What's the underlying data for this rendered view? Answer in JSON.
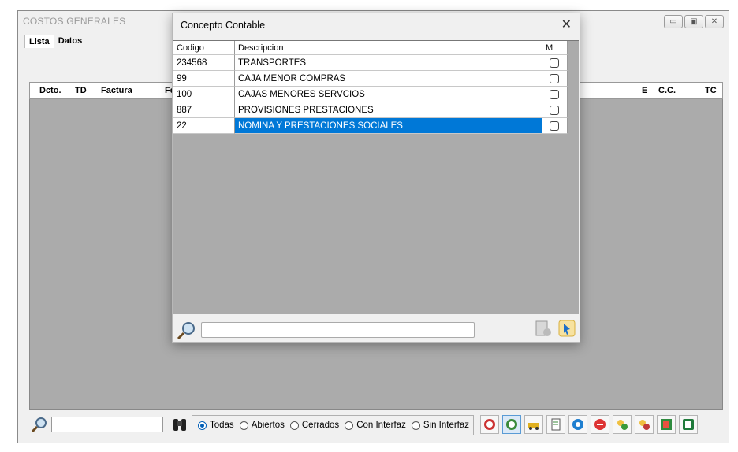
{
  "window": {
    "title": "COSTOS GENERALES",
    "tabs": [
      "Lista",
      "Datos"
    ],
    "columns": [
      "Dcto.",
      "TD",
      "Factura",
      "Fe",
      "E",
      "C.C.",
      "TC"
    ]
  },
  "filters": {
    "options": [
      "Todas",
      "Abiertos",
      "Cerrados",
      "Con Interfaz",
      "Sin Interfaz"
    ],
    "selected": "Todas"
  },
  "toolbar_icons": [
    "sales-icon",
    "receipt-icon",
    "truck-icon",
    "document-icon",
    "refresh-icon",
    "cancel-icon",
    "add-group-icon",
    "group-icon",
    "excel-grid-icon",
    "export-excel-icon"
  ],
  "modal": {
    "title": "Concepto Contable",
    "close": "✕",
    "columns": {
      "codigo": "Codigo",
      "descripcion": "Descripcion",
      "m": "M"
    },
    "rows": [
      {
        "codigo": "234568",
        "descripcion": "TRANSPORTES",
        "checked": false
      },
      {
        "codigo": "99",
        "descripcion": "CAJA  MENOR COMPRAS",
        "checked": false
      },
      {
        "codigo": "100",
        "descripcion": "CAJAS MENORES SERVCIOS",
        "checked": false
      },
      {
        "codigo": "887",
        "descripcion": "PROVISIONES PRESTACIONES",
        "checked": false
      },
      {
        "codigo": "22",
        "descripcion": "NOMINA Y PRESTACIONES SOCIALES",
        "checked": false
      }
    ],
    "selected_row": 4,
    "search_value": ""
  },
  "colors": {
    "selection": "#0078d7",
    "grid_bg": "#ababab"
  }
}
